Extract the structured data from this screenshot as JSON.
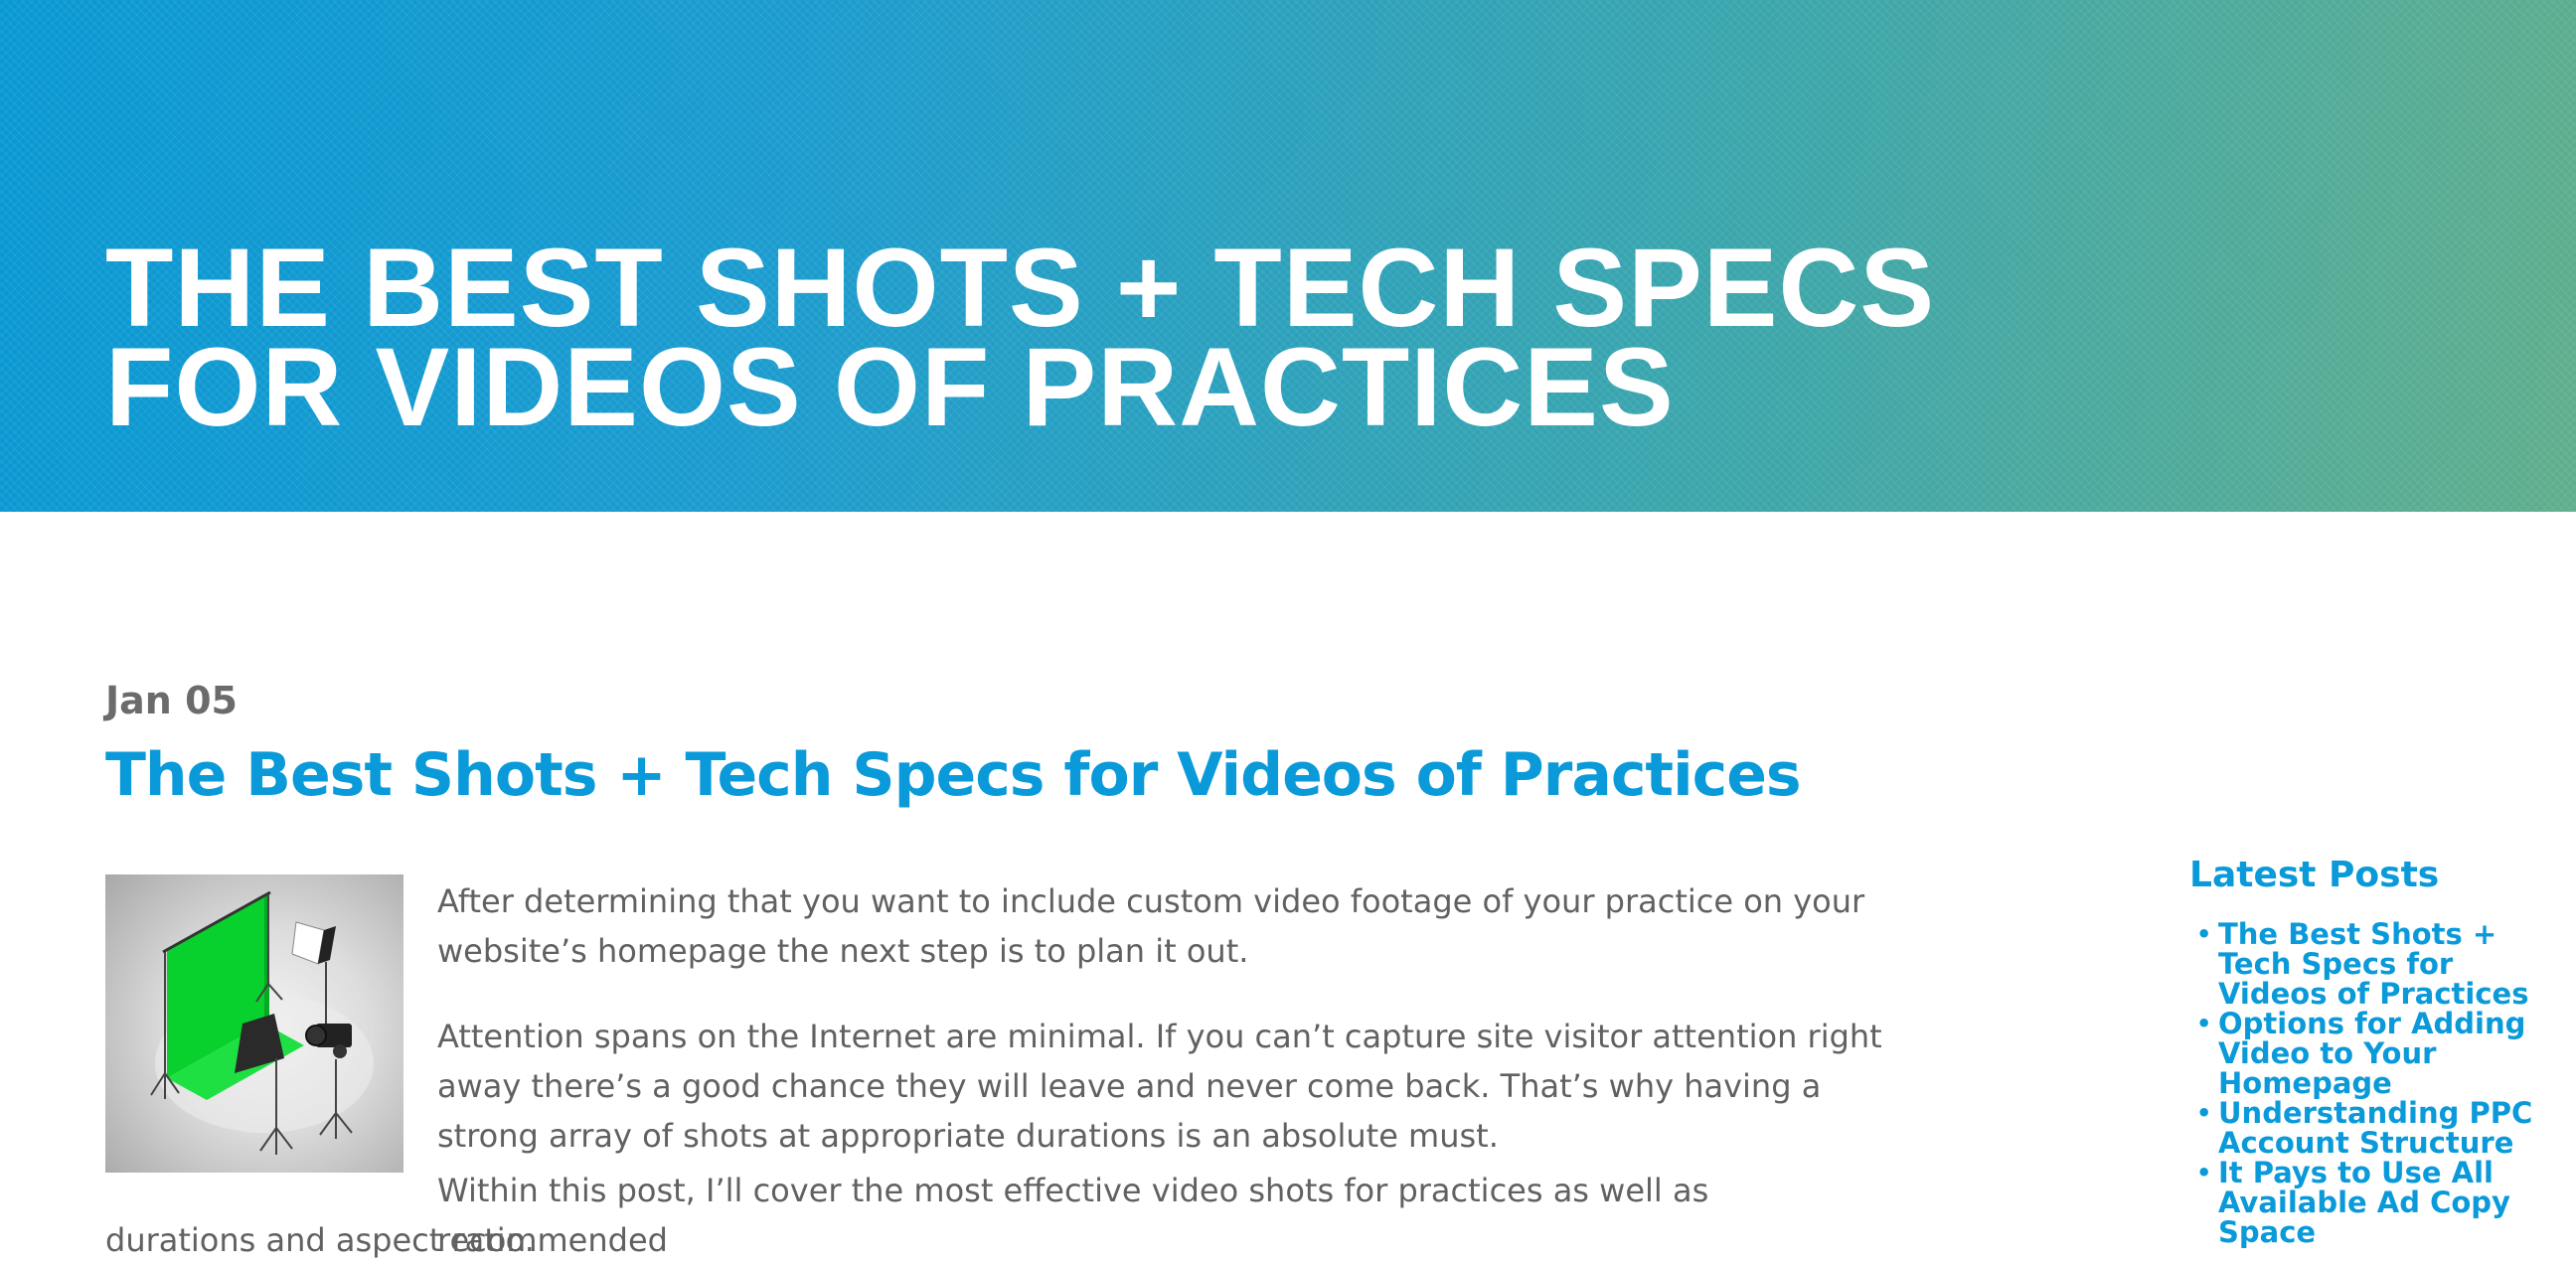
{
  "hero": {
    "title_line1": "THE BEST SHOTS + TECH SPECS",
    "title_line2": "FOR VIDEOS OF PRACTICES"
  },
  "post": {
    "date": "Jan 05",
    "title": "The Best Shots + Tech Specs for Videos of Practices",
    "image_icon": "video-studio-illustration",
    "paragraph1": "After determining that you want to include custom video footage of your practice on your website’s homepage the next step is to plan it out.",
    "paragraph2": "Attention spans on the Internet are minimal. If you can’t capture site visitor attention right away there’s a good chance they will leave and never come back. That’s why having a strong array of shots at appropriate durations is an absolute must.",
    "paragraph3_line1": "Within this post, I’ll cover the most effective video shots for practices as well as recommended",
    "paragraph3_line2": "durations and aspect ratio."
  },
  "sidebar": {
    "title": "Latest Posts",
    "items": [
      {
        "label": "The Best Shots + Tech Specs for Videos of Practices"
      },
      {
        "label": "Options for Adding Video to Your Homepage"
      },
      {
        "label": "Understanding PPC Account Structure"
      },
      {
        "label": "It Pays to Use All Available Ad Copy Space"
      }
    ]
  },
  "colors": {
    "accent": "#0a9ad9",
    "hero_start": "#0898d2",
    "hero_end": "#5fae8c",
    "body_text": "#616161",
    "date_text": "#6b6b6b"
  }
}
